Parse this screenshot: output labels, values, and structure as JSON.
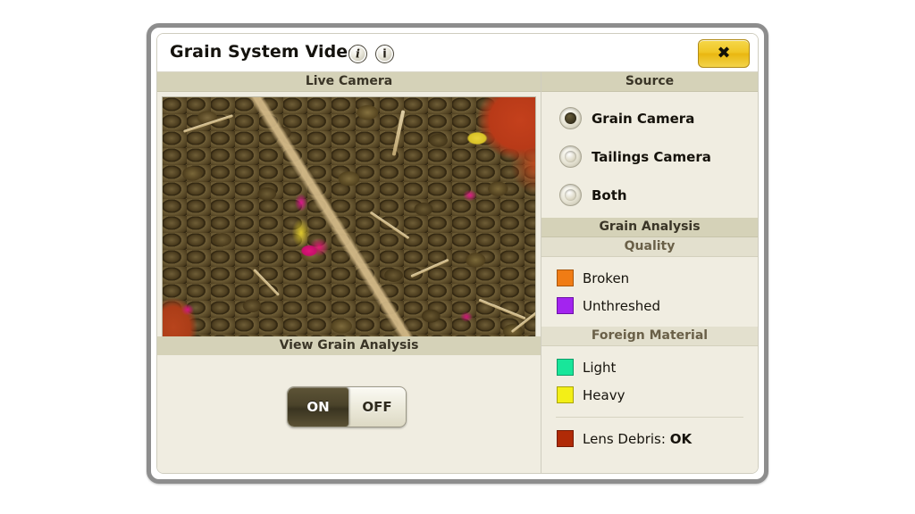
{
  "window": {
    "title": "Grain System Video",
    "info_icon_1": "i",
    "info_icon_2": "i",
    "close_label": "✖"
  },
  "left_panel": {
    "camera_header": "Live Camera",
    "view_analysis_header": "View Grain Analysis",
    "toggle": {
      "on_label": "ON",
      "off_label": "OFF",
      "state": "ON"
    }
  },
  "source_panel": {
    "header": "Source",
    "options": [
      {
        "label": "Grain Camera",
        "selected": true
      },
      {
        "label": "Tailings Camera",
        "selected": false
      },
      {
        "label": "Both",
        "selected": false
      }
    ]
  },
  "grain_analysis": {
    "header": "Grain Analysis",
    "quality": {
      "header": "Quality",
      "items": [
        {
          "label": "Broken",
          "color": "#f07c15"
        },
        {
          "label": "Unthreshed",
          "color": "#a324ef"
        }
      ]
    },
    "foreign_material": {
      "header": "Foreign Material",
      "items": [
        {
          "label": "Light",
          "color": "#18e69a"
        },
        {
          "label": "Heavy",
          "color": "#f3ef17"
        }
      ]
    },
    "lens_debris": {
      "label": "Lens Debris:",
      "value": "OK",
      "color": "#b02a07"
    }
  }
}
